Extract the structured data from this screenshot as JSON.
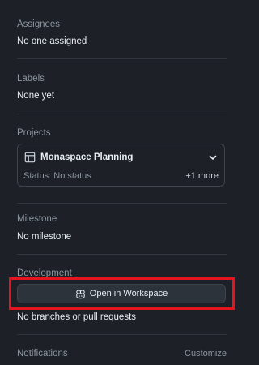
{
  "assignees": {
    "title": "Assignees",
    "value": "No one assigned"
  },
  "labels": {
    "title": "Labels",
    "value": "None yet"
  },
  "projects": {
    "title": "Projects",
    "project_name": "Monaspace Planning",
    "status": "Status: No status",
    "more": "+1 more"
  },
  "milestone": {
    "title": "Milestone",
    "value": "No milestone"
  },
  "development": {
    "title": "Development",
    "button_label": "Open in Workspace",
    "value": "No branches or pull requests"
  },
  "notifications": {
    "title": "Notifications",
    "customize_label": "Customize"
  },
  "colors": {
    "background": "#1d2127",
    "muted_text": "#8d96a0",
    "primary_text": "#e6edf3",
    "border": "#30363d",
    "highlight": "#e4151f"
  }
}
